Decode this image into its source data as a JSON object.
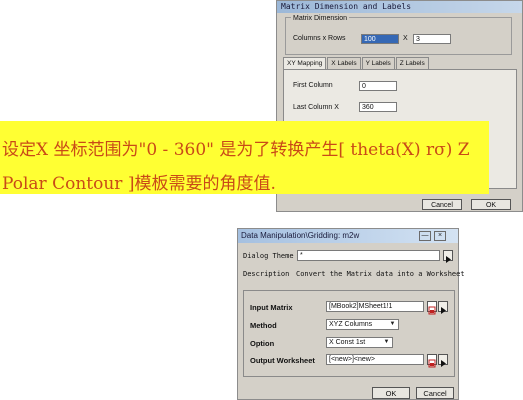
{
  "dialog1": {
    "title": "Matrix Dimension and Labels",
    "group_label": "Matrix Dimension",
    "columns_x_rows_label": "Columns  x  Rows",
    "columns_value": "100",
    "x_sep": "X",
    "rows_value": "3",
    "tabs": [
      "XY Mapping",
      "X Labels",
      "Y Labels",
      "Z Labels"
    ],
    "first_column_label": "First Column",
    "first_column_value": "0",
    "last_column_label": "Last Column X",
    "last_column_value": "360",
    "cancel_label": "Cancel",
    "ok_label": "OK"
  },
  "banner": {
    "line1": "设定X 坐标范围为\"0 - 360\" 是为了转换产生[ theta(X) rσ) Z",
    "line2": "Polar Contour ]模板需要的角度值.",
    "bg_color": "#ffff33",
    "text_color": "#c94a17"
  },
  "dialog2": {
    "title": "Data Manipulation\\Gridding: m2w",
    "dialog_theme_label": "Dialog Theme",
    "dialog_theme_value": "*",
    "description_label": "Description",
    "description_text": "Convert the Matrix data into a Worksheet",
    "input_matrix_label": "Input Matrix",
    "input_matrix_value": "[MBook2]MSheet1!1",
    "method_label": "Method",
    "method_value": "XYZ Columns",
    "option_label": "Option",
    "option_value": "X Const 1st",
    "output_worksheet_label": "Output Worksheet",
    "output_worksheet_value": "[<new>]<new>",
    "ok_label": "OK",
    "cancel_label": "Cancel"
  }
}
